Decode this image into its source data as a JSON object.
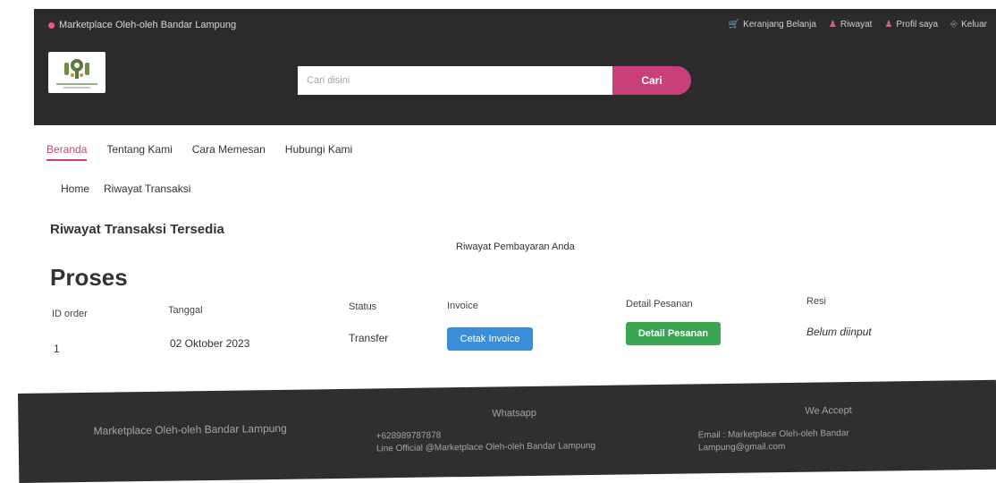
{
  "topbar": {
    "brand": "Marketplace Oleh-oleh Bandar Lampung",
    "links": [
      {
        "label": "Keranjang Belanja",
        "icon": "cart-icon"
      },
      {
        "label": "Riwayat",
        "icon": "user-icon"
      },
      {
        "label": "Profil saya",
        "icon": "user-icon"
      },
      {
        "label": "Keluar",
        "icon": "logout-icon"
      }
    ]
  },
  "search": {
    "placeholder": "Cari disini",
    "button_label": "Cari"
  },
  "mainnav": [
    {
      "label": "Beranda",
      "active": true
    },
    {
      "label": "Tentang Kami",
      "active": false
    },
    {
      "label": "Cara Memesan",
      "active": false
    },
    {
      "label": "Hubungi Kami",
      "active": false
    }
  ],
  "breadcrumb": [
    "Home",
    "Riwayat Transaksi"
  ],
  "main": {
    "title": "Riwayat Transaksi Tersedia",
    "subtitle": "Riwayat Pembayaran Anda",
    "section": "Proses"
  },
  "table": {
    "headers": [
      "ID order",
      "Tanggal",
      "Status",
      "Invoice",
      "Detail Pesanan",
      "Resi"
    ],
    "rows": [
      {
        "id": "1",
        "tanggal": "02 Oktober 2023",
        "status": "Transfer",
        "invoice_button": "Cetak Invoice",
        "detail_button": "Detail Pesanan",
        "resi": "Belum diinput"
      }
    ]
  },
  "footer": {
    "brand": "Marketplace Oleh-oleh Bandar Lampung",
    "whatsapp_title": "Whatsapp",
    "phone": "+628989787878",
    "line": "Line Official @Marketplace Oleh-oleh Bandar Lampung",
    "we_accept": "We Accept",
    "email_label": "Email : Marketplace Oleh-oleh Bandar",
    "email_cont": "Lampung@gmail.com"
  },
  "colors": {
    "accent": "#c94078",
    "header_bg": "#2b2b2b",
    "invoice_btn": "#3a8fd8",
    "detail_btn": "#3aa654"
  }
}
